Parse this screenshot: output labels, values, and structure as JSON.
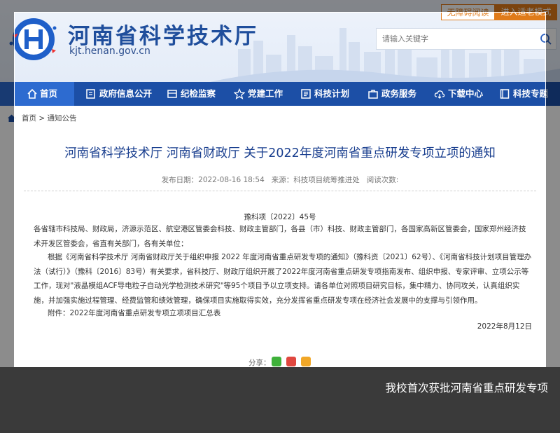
{
  "header": {
    "site_title": "河南省科学技术厅",
    "site_domain": "kjt.henan.gov.cn",
    "btn_accessible": "无障碍阅读",
    "btn_elder": "进入适老模式",
    "search_placeholder": "请输入关键字"
  },
  "nav": {
    "items": [
      {
        "label": "首页",
        "icon": "home-icon"
      },
      {
        "label": "政府信息公开",
        "icon": "document-icon"
      },
      {
        "label": "纪检监察",
        "icon": "folder-icon"
      },
      {
        "label": "党建工作",
        "icon": "star-icon"
      },
      {
        "label": "科技计划",
        "icon": "list-icon"
      },
      {
        "label": "政务服务",
        "icon": "briefcase-icon"
      },
      {
        "label": "下载中心",
        "icon": "cloud-download-icon"
      },
      {
        "label": "科技专题",
        "icon": "book-icon"
      }
    ]
  },
  "breadcrumb": {
    "home": "首页",
    "separator": " > ",
    "current": "通知公告"
  },
  "article": {
    "title": "河南省科学技术厅 河南省财政厅 关于2022年度河南省重点研发专项立项的通知",
    "publish_label": "发布日期：",
    "publish_date": "2022-08-16 18:54",
    "source_label": "来源：",
    "source": "科技项目统筹推进处",
    "views_label": "阅读次数:",
    "doc_number": "豫科项〔2022〕45号",
    "para_1": "各省辖市科技局、财政局，济源示范区、航空港区管委会科技、财政主管部门，各县（市）科技、财政主管部门，各国家高新区管委会，国家郑州经济技术开发区管委会，省直有关部门，各有关单位：",
    "para_2": "根据《河南省科学技术厅 河南省财政厅关于组织申报 2022 年度河南省重点研发专项的通知》（豫科资〔2021〕62号）、《河南省科技计划项目管理办法（试行）》（豫科〔2016〕83号）有关要求，省科技厅、财政厅组织开展了2022年度河南省重点研发专项指南发布、组织申报、专家评审、立项公示等工作，现对\"液晶模组ACF导电粒子自动光学检测技术研究\"等95个项目予以立项支持。请各单位对照项目研究目标，集中精力、协同攻关，认真组织实施，并加强实施过程管理、经费监管和绩效管理，确保项目实施取得实效，充分发挥省重点研发专项在经济社会发展中的支撑与引领作用。",
    "para_3": "附件：2022年度河南省重点研发专项立项项目汇总表",
    "date": "2022年8月12日",
    "share_label": "分享："
  },
  "caption": "我校首次获批河南省重点研发专项",
  "colors": {
    "nav_bg": "#1c4fa6",
    "nav_active": "#2d6bd0",
    "title_blue": "#1a3f8f",
    "accent_orange": "#e07b1a",
    "caption_bg": "#3a3a3a"
  }
}
